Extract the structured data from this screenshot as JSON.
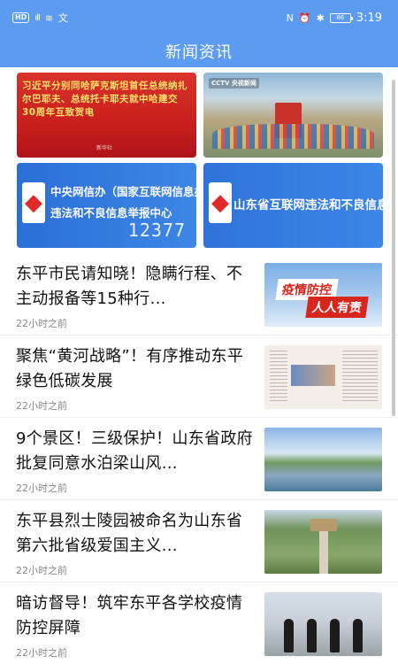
{
  "status_bar": {
    "hd": "HD",
    "signal": "⁴ᴳ.ıl",
    "wifi": "📶",
    "extra": "文",
    "battery": "86",
    "time": "3:19"
  },
  "header": {
    "title": "新闻资讯"
  },
  "banners": {
    "b1": {
      "text": "习近平分别同哈萨克斯坦首任总统纳扎尔巴耶夫、总统托卡耶夫就中哈建交30周年互致贺电",
      "stamp": "新华社"
    },
    "b2": {
      "tag": "CCTV 央视新闻"
    },
    "b3": {
      "line1": "中央网信办（国家互联网信息办公室）",
      "line2": "违法和不良信息举报中心",
      "number": "12377"
    },
    "b4": {
      "text": "山东省互联网违法和不良信息举报中心"
    }
  },
  "news": [
    {
      "title": "东平市民请知晓！隐瞒行程、不主动报备等15种行...",
      "time": "22小时之前",
      "thumb_text_a": "疫情防控",
      "thumb_text_b": "人人有责"
    },
    {
      "title": "聚焦“黄河战略”！有序推动东平绿色低碳发展",
      "time": "22小时之前"
    },
    {
      "title": "9个景区！三级保护！山东省政府批复同意水泊梁山风...",
      "time": "22小时之前"
    },
    {
      "title": "东平县烈士陵园被命名为山东省第六批省级爱国主义...",
      "time": "22小时之前"
    },
    {
      "title": "暗访督导！筑牢东平各学校疫情防控屏障",
      "time": "22小时之前"
    }
  ]
}
